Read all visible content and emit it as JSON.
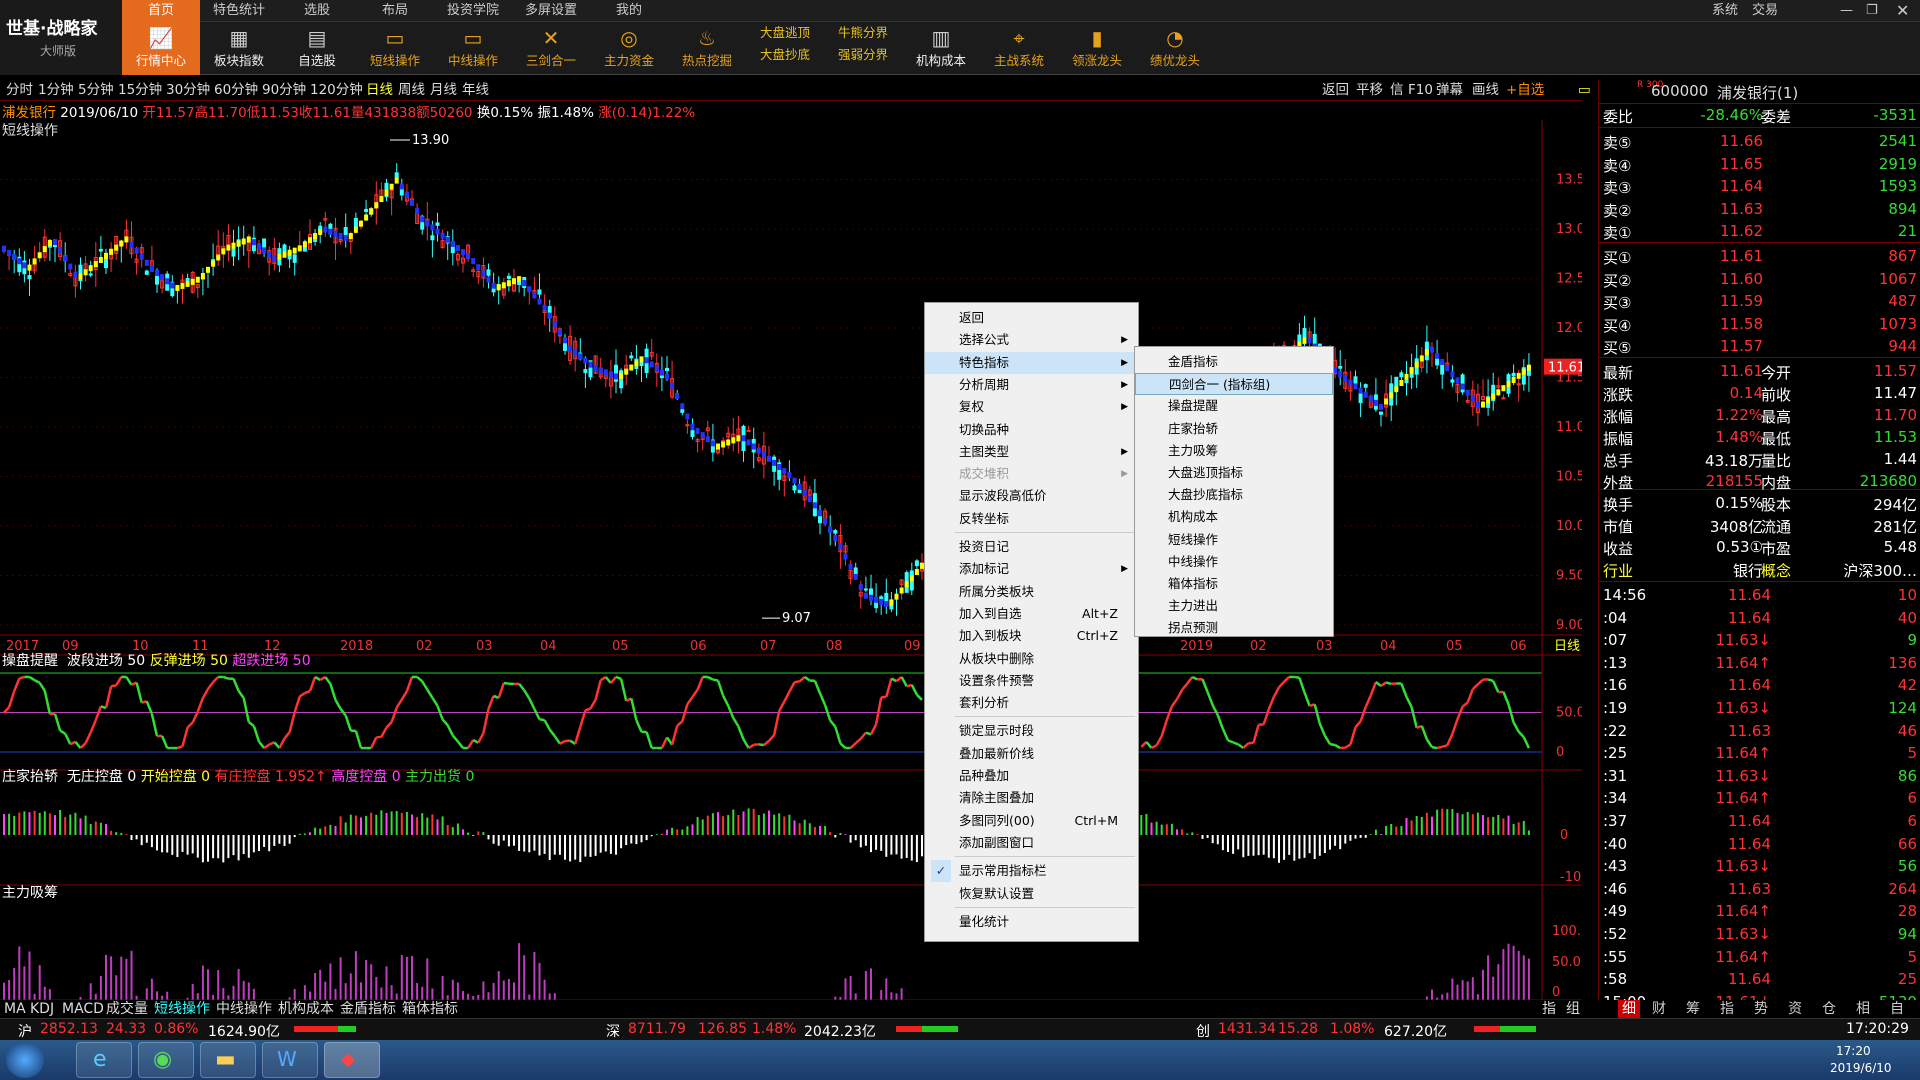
{
  "app": {
    "brand": "世基·战略家",
    "version": "大师版"
  },
  "menu": [
    "首页",
    "特色统计",
    "选股",
    "布局",
    "投资学院",
    "多屏设置",
    "我的"
  ],
  "window_controls": {
    "sys": "系统",
    "trade": "交易"
  },
  "toolbar": [
    {
      "label": "行情中心",
      "icon": "chart-icon",
      "active": true
    },
    {
      "label": "板块指数",
      "icon": "grid-icon"
    },
    {
      "label": "自选股",
      "icon": "doc-icon"
    },
    {
      "label": "短线操作",
      "icon": "monitor-icon"
    },
    {
      "label": "中线操作",
      "icon": "monitor-icon"
    },
    {
      "label": "三剑合一",
      "icon": "swords-icon"
    },
    {
      "label": "主力资金",
      "icon": "coin-icon"
    },
    {
      "label": "热点挖掘",
      "icon": "fire-icon"
    }
  ],
  "toolbar_double": [
    {
      "l1": "大盘逃顶",
      "l2": "大盘抄底"
    },
    {
      "l1": "牛熊分界",
      "l2": "强弱分界"
    }
  ],
  "toolbar_tail": [
    {
      "label": "机构成本",
      "icon": "building-icon"
    },
    {
      "label": "主战系统",
      "icon": "target-icon"
    },
    {
      "label": "领涨龙头",
      "icon": "bars-icon"
    },
    {
      "label": "绩优龙头",
      "icon": "pie-icon"
    }
  ],
  "periods": [
    "分时",
    "1分钟",
    "5分钟",
    "15分钟",
    "30分钟",
    "60分钟",
    "90分钟",
    "120分钟",
    "日线",
    "周线",
    "月线",
    "年线"
  ],
  "period_selected": "日线",
  "chart_actions": [
    "返回",
    "平移",
    "信",
    "F10",
    "弹幕",
    "画线",
    "+自选"
  ],
  "info_line": {
    "name": "浦发银行",
    "date": "2019/06/10",
    "open": "开11.57",
    "high": "高11.70",
    "low": "低11.53",
    "close": "收11.61",
    "vol": "量431838",
    "amt": "额50260",
    "turn": "换0.15%",
    "amp": "振1.48%",
    "chg": "涨(0.14)1.22%"
  },
  "main_title": "短线操作",
  "price_axis": [
    "13.50",
    "13.00",
    "12.50",
    "12.00",
    "11.50",
    "11.00",
    "10.50",
    "10.00",
    "9.50",
    "9.00"
  ],
  "price_marks": {
    "high": "13.90",
    "low": "9.07",
    "last": "11.61"
  },
  "date_axis": [
    "2017",
    "09",
    "10",
    "11",
    "12",
    "2018",
    "02",
    "03",
    "04",
    "05",
    "06",
    "07",
    "08",
    "09",
    "2019",
    "02",
    "03",
    "04",
    "05",
    "06"
  ],
  "date_axis_label": "日线",
  "ind1": {
    "title": "操盘提醒",
    "a": "波段进场 50",
    "b": "反弹进场 50",
    "c": "超跌进场 50",
    "axis": [
      "50.00",
      "0"
    ]
  },
  "ind2": {
    "title": "庄家抬轿",
    "a": "无庄控盘 0",
    "b": "开始控盘 0",
    "c": "有庄控盘 1.952↑",
    "d": "高度控盘 0",
    "e": "主力出货 0",
    "axis": [
      "0",
      "-10.00"
    ]
  },
  "ind3": {
    "title": "主力吸筹",
    "axis": [
      "100.00",
      "50.00",
      "0"
    ]
  },
  "bottom_tabs": [
    "MA",
    "KDJ",
    "MACD",
    "成交量",
    "短线操作",
    "中线操作",
    "机构成本",
    "金盾指标",
    "箱体指标"
  ],
  "bottom_tab_selected": "短线操作",
  "context_menu": [
    {
      "label": "返回"
    },
    {
      "label": "选择公式",
      "sub": true
    },
    {
      "label": "特色指标",
      "sub": true,
      "hl": true
    },
    {
      "label": "分析周期",
      "sub": true
    },
    {
      "label": "复权",
      "sub": true
    },
    {
      "label": "切换品种"
    },
    {
      "label": "主图类型",
      "sub": true
    },
    {
      "label": "成交堆积",
      "sub": true,
      "dis": true
    },
    {
      "label": "显示波段高低价"
    },
    {
      "label": "反转坐标"
    },
    {
      "sep": true
    },
    {
      "label": "投资日记"
    },
    {
      "label": "添加标记",
      "sub": true
    },
    {
      "label": "所属分类板块"
    },
    {
      "label": "加入到自选",
      "sc": "Alt+Z"
    },
    {
      "label": "加入到板块",
      "sc": "Ctrl+Z"
    },
    {
      "label": "从板块中删除"
    },
    {
      "label": "设置条件预警"
    },
    {
      "label": "套利分析"
    },
    {
      "sep": true
    },
    {
      "label": "锁定显示时段"
    },
    {
      "label": "叠加最新价线"
    },
    {
      "label": "品种叠加"
    },
    {
      "label": "清除主图叠加"
    },
    {
      "label": "多图同列(00)",
      "sc": "Ctrl+M"
    },
    {
      "label": "添加副图窗口"
    },
    {
      "sep": true
    },
    {
      "label": "显示常用指标栏",
      "check": true
    },
    {
      "label": "恢复默认设置"
    },
    {
      "sep": true
    },
    {
      "label": "量化统计"
    }
  ],
  "submenu": [
    "金盾指标",
    "四剑合一        (指标组)",
    "操盘提醒",
    "庄家抬轿",
    "主力吸筹",
    "大盘逃顶指标",
    "大盘抄底指标",
    "机构成本",
    "短线操作",
    "中线操作",
    "箱体指标",
    "主力进出",
    "拐点预测"
  ],
  "submenu_hl": 1,
  "quote": {
    "code": "600000",
    "name": "浦发银行(1)",
    "badge": "R 300",
    "weibi": [
      "委比",
      "-28.46%",
      "委差",
      "-3531"
    ],
    "sells": [
      [
        "卖⑤",
        "11.66",
        "2541"
      ],
      [
        "卖④",
        "11.65",
        "2919"
      ],
      [
        "卖③",
        "11.64",
        "1593"
      ],
      [
        "卖②",
        "11.63",
        "894"
      ],
      [
        "卖①",
        "11.62",
        "21"
      ]
    ],
    "buys": [
      [
        "买①",
        "11.61",
        "867"
      ],
      [
        "买②",
        "11.60",
        "1067"
      ],
      [
        "买③",
        "11.59",
        "487"
      ],
      [
        "买④",
        "11.58",
        "1073"
      ],
      [
        "买⑤",
        "11.57",
        "944"
      ]
    ],
    "stats": [
      [
        "最新",
        "11.61",
        "今开",
        "11.57"
      ],
      [
        "涨跌",
        "0.14",
        "前收",
        "11.47"
      ],
      [
        "涨幅",
        "1.22%",
        "最高",
        "11.70"
      ],
      [
        "振幅",
        "1.48%",
        "最低",
        "11.53"
      ],
      [
        "总手",
        "43.18万",
        "量比",
        "1.44"
      ],
      [
        "外盘",
        "218155",
        "内盘",
        "213680"
      ]
    ],
    "stats2": [
      [
        "换手",
        "0.15%",
        "股本",
        "294亿"
      ],
      [
        "市值",
        "3408亿",
        "流通",
        "281亿"
      ],
      [
        "收益",
        "0.53①",
        "市盈",
        "5.48"
      ],
      [
        "行业",
        "银行",
        "概念",
        "沪深300…"
      ]
    ],
    "ticks": [
      [
        "14:56",
        "11.64",
        "10"
      ],
      [
        ":04",
        "11.64",
        "40"
      ],
      [
        ":07",
        "11.63↓",
        "9"
      ],
      [
        ":13",
        "11.64↑",
        "136"
      ],
      [
        ":16",
        "11.64",
        "42"
      ],
      [
        ":19",
        "11.63↓",
        "124"
      ],
      [
        ":22",
        "11.63",
        "46"
      ],
      [
        ":25",
        "11.64↑",
        "5"
      ],
      [
        ":31",
        "11.63↓",
        "86"
      ],
      [
        ":34",
        "11.64↑",
        "6"
      ],
      [
        ":37",
        "11.64",
        "6"
      ],
      [
        ":40",
        "11.64",
        "66"
      ],
      [
        ":43",
        "11.63↓",
        "56"
      ],
      [
        ":46",
        "11.63",
        "264"
      ],
      [
        ":49",
        "11.64↑",
        "28"
      ],
      [
        ":52",
        "11.63↓",
        "94"
      ],
      [
        ":55",
        "11.64↑",
        "5"
      ],
      [
        ":58",
        "11.64",
        "25"
      ],
      [
        "15:00",
        "11.61↓",
        "5139"
      ]
    ],
    "tabs": [
      "细",
      "财",
      "筹",
      "指",
      "势",
      "资",
      "仓",
      "相",
      "自"
    ]
  },
  "mini_tabs": [
    "指",
    "组"
  ],
  "status": {
    "sh_label": "沪",
    "sh": "2852.13",
    "sh_chg": "24.33",
    "sh_pct": "0.86%",
    "sh_amt": "1624.90亿",
    "sz_label": "深",
    "sz": "8711.79",
    "sz_chg": "126.85",
    "sz_pct": "1.48%",
    "sz_amt": "2042.23亿",
    "cy_label": "创",
    "cy": "1431.34",
    "cy_chg": "15.28",
    "cy_pct": "1.08%",
    "cy_amt": "627.20亿",
    "clock": "17:20:29"
  },
  "taskbar": {
    "time": "17:20",
    "date": "2019/6/10"
  },
  "chart_data": {
    "type": "candlestick",
    "title": "浦发银行 短线操作",
    "high": 13.9,
    "low": 9.07,
    "last": 11.61,
    "ylim": [
      9.0,
      13.9
    ],
    "close_path": [
      12.8,
      12.6,
      12.9,
      12.5,
      12.7,
      12.9,
      12.6,
      12.4,
      12.5,
      12.8,
      12.9,
      12.7,
      12.8,
      13.0,
      12.9,
      13.2,
      13.5,
      13.1,
      12.9,
      12.7,
      12.4,
      12.5,
      12.2,
      11.8,
      11.6,
      11.5,
      11.7,
      11.5,
      11.0,
      10.8,
      10.9,
      10.7,
      10.5,
      10.2,
      9.8,
      9.3,
      9.2,
      9.5,
      9.8,
      10.1,
      10.0,
      10.3,
      10.1,
      10.4,
      10.3,
      10.2,
      10.5,
      10.6,
      10.4,
      10.9,
      11.2,
      11.5,
      11.7,
      11.9,
      11.6,
      11.4,
      11.2,
      11.5,
      11.8,
      11.5,
      11.2,
      11.4,
      11.6
    ]
  }
}
